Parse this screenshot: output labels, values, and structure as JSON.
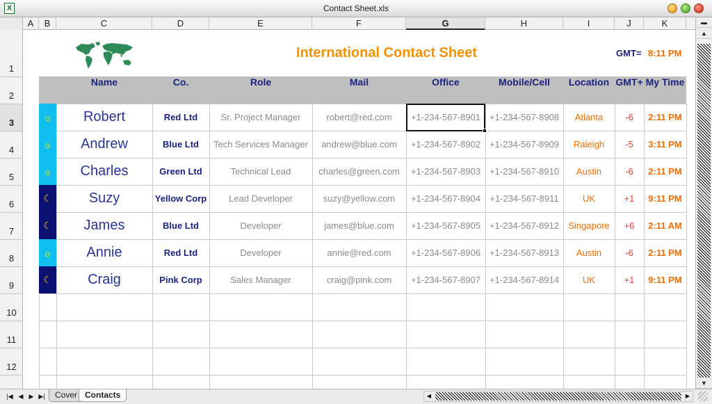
{
  "window": {
    "title": "Contact Sheet.xls",
    "app_icon": "excel-icon"
  },
  "columns": [
    "A",
    "B",
    "C",
    "D",
    "E",
    "F",
    "G",
    "H",
    "I",
    "J",
    "K"
  ],
  "active_column": "G",
  "rows": [
    "1",
    "2",
    "3",
    "4",
    "5",
    "6",
    "7",
    "8",
    "9",
    "10",
    "11",
    "12"
  ],
  "active_row": "3",
  "sheet": {
    "title": "International Contact Sheet",
    "gmt_label": "GMT=",
    "gmt_time": "8:11 PM",
    "logo": "world-map-icon",
    "headers": [
      "Name",
      "Co.",
      "Role",
      "Mail",
      "Office",
      "Mobile/Cell",
      "Location",
      "GMT+",
      "My Time"
    ],
    "contacts": [
      {
        "status": "day",
        "icon": "sun-icon",
        "name": "Robert",
        "company": "Red Ltd",
        "role": "Sr. Project Manager",
        "mail": "robert@red.com",
        "office": "+1-234-567-8901",
        "mobile": "+1-234-567-8908",
        "location": "Atlanta",
        "gmt": "-6",
        "my_time": "2:11 PM"
      },
      {
        "status": "day",
        "icon": "sun-icon",
        "name": "Andrew",
        "company": "Blue Ltd",
        "role": "Tech Services Manager",
        "mail": "andrew@blue.com",
        "office": "+1-234-567-8902",
        "mobile": "+1-234-567-8909",
        "location": "Raleigh",
        "gmt": "-5",
        "my_time": "3:11 PM"
      },
      {
        "status": "day",
        "icon": "sun-icon",
        "name": "Charles",
        "company": "Green Ltd",
        "role": "Technical Lead",
        "mail": "charles@green.com",
        "office": "+1-234-567-8903",
        "mobile": "+1-234-567-8910",
        "location": "Austin",
        "gmt": "-6",
        "my_time": "2:11 PM"
      },
      {
        "status": "night",
        "icon": "moon-icon",
        "name": "Suzy",
        "company": "Yellow Corp",
        "role": "Lead Developer",
        "mail": "suzy@yellow.com",
        "office": "+1-234-567-8904",
        "mobile": "+1-234-567-8911",
        "location": "UK",
        "gmt": "+1",
        "my_time": "9:11 PM"
      },
      {
        "status": "night",
        "icon": "moon-icon",
        "name": "James",
        "company": "Blue Ltd",
        "role": "Developer",
        "mail": "james@blue.com",
        "office": "+1-234-567-8905",
        "mobile": "+1-234-567-8912",
        "location": "Singapore",
        "gmt": "+6",
        "my_time": "2:11 AM"
      },
      {
        "status": "day",
        "icon": "sun-icon",
        "name": "Annie",
        "company": "Red Ltd",
        "role": "Developer",
        "mail": "annie@red.com",
        "office": "+1-234-567-8906",
        "mobile": "+1-234-567-8913",
        "location": "Austin",
        "gmt": "-6",
        "my_time": "2:11 PM"
      },
      {
        "status": "night",
        "icon": "moon-icon",
        "name": "Craig",
        "company": "Pink Corp",
        "role": "Sales Manager",
        "mail": "craig@pink.com",
        "office": "+1-234-567-8907",
        "mobile": "+1-234-567-8914",
        "location": "UK",
        "gmt": "+1",
        "my_time": "9:11 PM"
      }
    ]
  },
  "tabs": [
    {
      "label": "Cover",
      "active": false
    },
    {
      "label": "Contacts",
      "active": true
    }
  ],
  "colors": {
    "title": "#f39200",
    "header_band": "#bfbfbf",
    "header_text": "#1a237e",
    "day_fill": "#12bdf0",
    "night_fill": "#0a1070",
    "accent_orange": "#ef6c00",
    "gmt_red": "#e53935"
  }
}
